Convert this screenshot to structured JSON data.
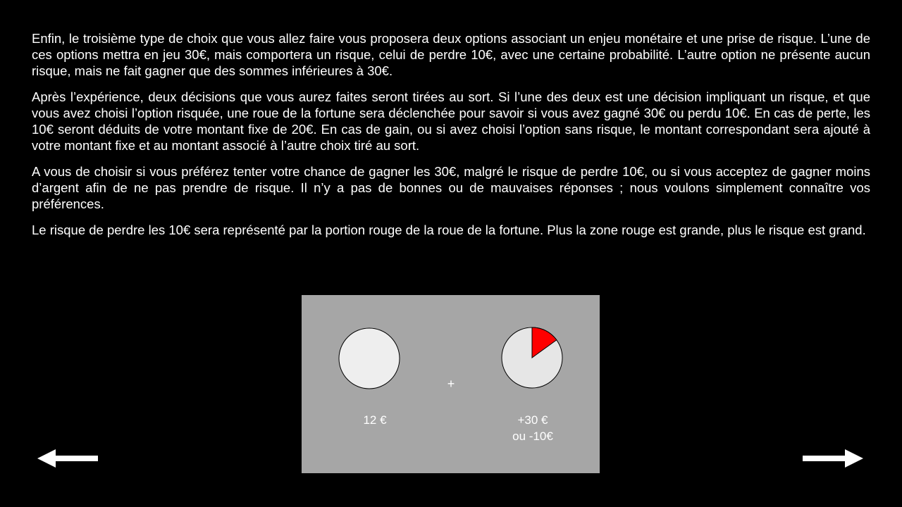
{
  "instructions": {
    "paragraphs": [
      "Enfin, le troisième type de choix que vous allez faire vous proposera deux options associant un enjeu monétaire et une prise de risque. L’une de ces options mettra en jeu 30€, mais comportera un risque, celui de perdre 10€, avec une certaine probabilité. L’autre option ne présente aucun risque, mais ne fait gagner que des sommes inférieures à 30€.",
      "Après l’expérience, deux décisions que vous aurez faites seront tirées au sort. Si l’une des deux est une décision impliquant un risque, et que vous avez choisi l’option risquée, une roue de la fortune sera déclenchée pour savoir si vous avez gagné 30€ ou perdu 10€. En cas de perte, les 10€ seront déduits de votre montant fixe de 20€. En cas de gain, ou si avez choisi l’option sans risque, le montant correspondant sera ajouté à votre montant fixe et au montant associé à l’autre choix tiré au sort.",
      "A vous de choisir si vous préférez tenter votre chance de gagner les 30€, malgré le risque de perdre 10€, ou si vous acceptez de gagner moins d’argent afin de ne pas prendre de risque. Il n’y a pas de bonnes ou de mauvaises réponses ; nous voulons simplement connaître vos préférences.",
      "Le risque de perdre les 10€ sera représenté par la portion rouge de la roue de la fortune. Plus la zone rouge est grande, plus le risque est grand."
    ]
  },
  "example": {
    "safe_option": {
      "amount_label": "12 €",
      "risk_fraction": 0
    },
    "plus_label": "+",
    "risky_option": {
      "gain_label": "+30 €",
      "loss_label": "ou -10€",
      "risk_fraction": 0.15
    },
    "colors": {
      "panel": "#a6a6a6",
      "wheel_fill": "#e6e6e6",
      "risk_fill": "#ff0000",
      "outline": "#000000"
    }
  },
  "navigation": {
    "back_icon": "arrow-left-icon",
    "next_icon": "arrow-right-icon"
  }
}
